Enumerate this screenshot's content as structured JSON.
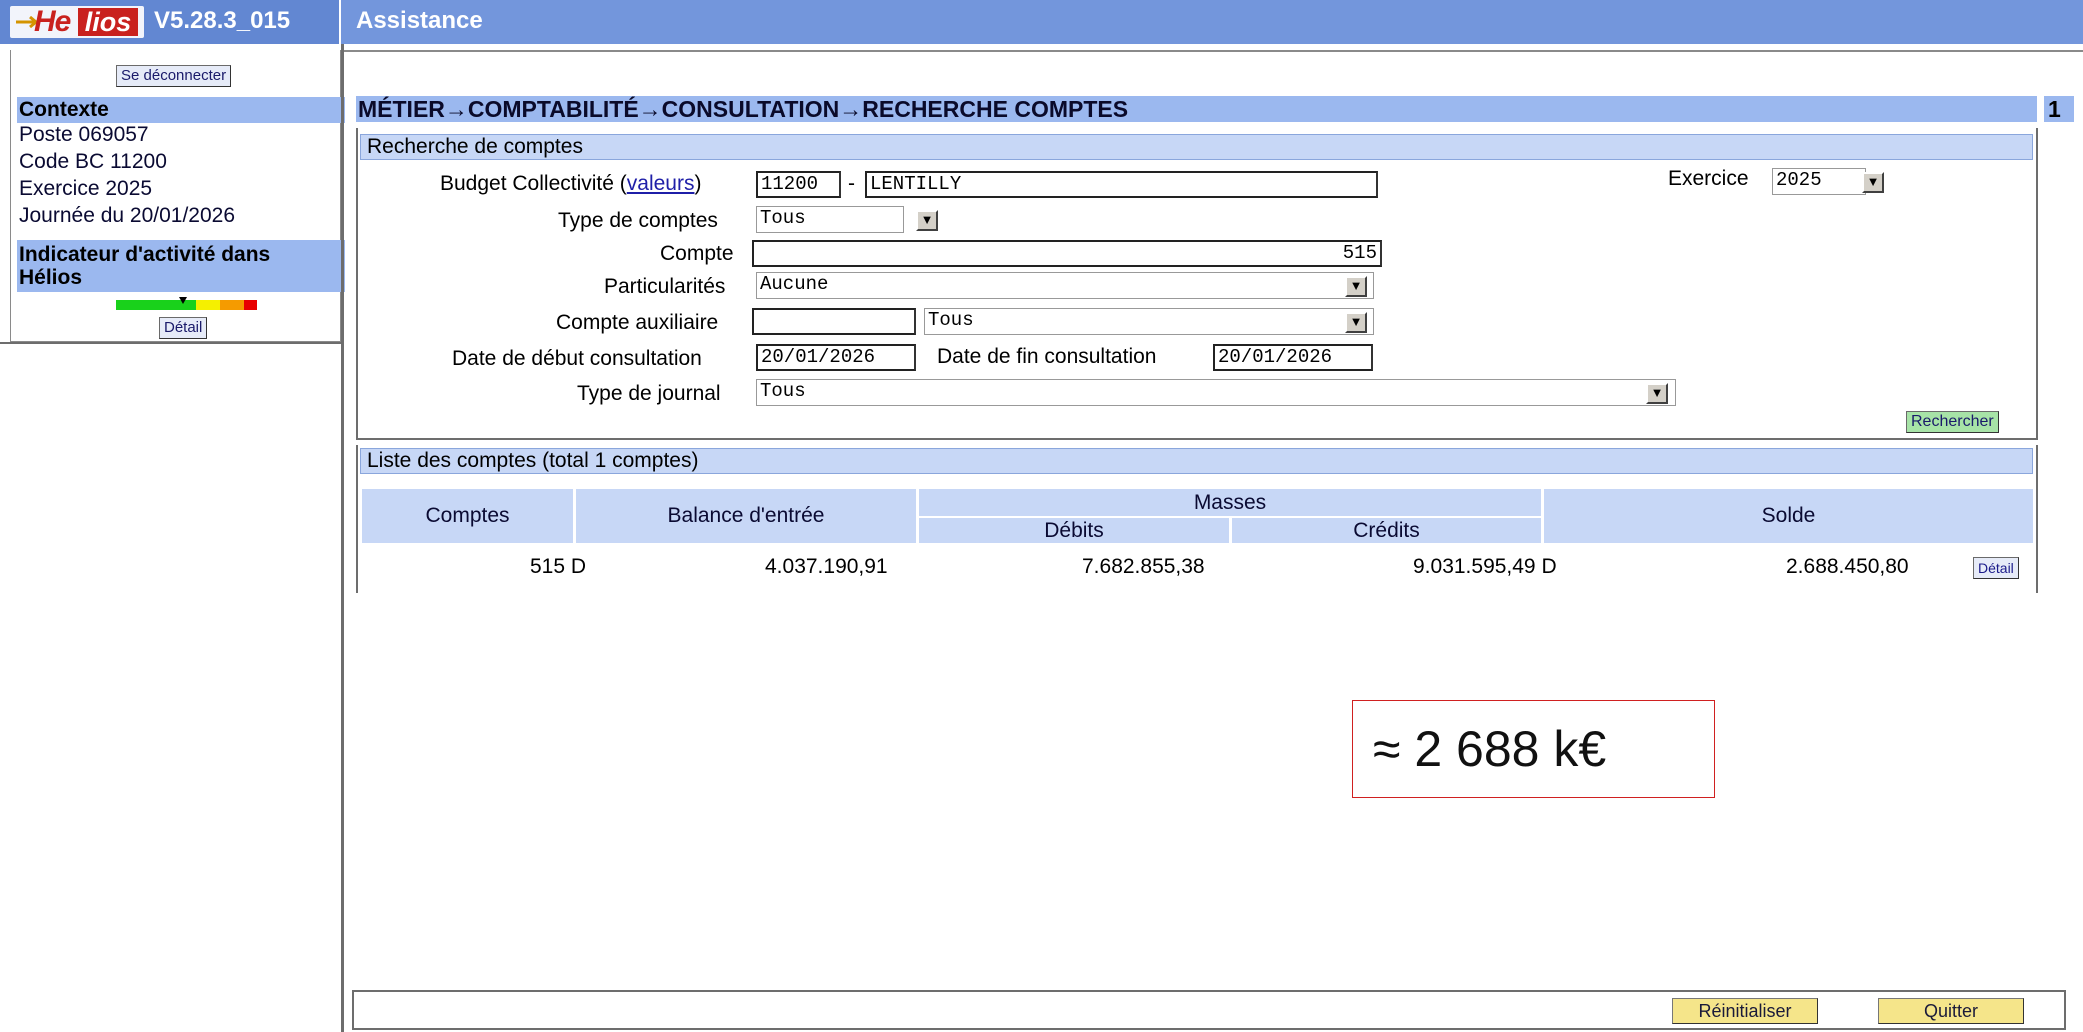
{
  "header": {
    "logo_text": "Helios",
    "version": "V5.28.3_015",
    "assistance": "Assistance"
  },
  "sidebar": {
    "logout_label": "Se déconnecter",
    "context_title": "Contexte",
    "context_lines": [
      "Poste 069057",
      "Code BC 11200",
      "Exercice 2025",
      "Journée du 20/01/2026"
    ],
    "indicator_title_line1": "Indicateur d'activité dans",
    "indicator_title_line2": "Hélios",
    "indicator_colors": [
      "#19d11b",
      "#f5f000",
      "#f59b00",
      "#e80000"
    ],
    "detail_label": "Détail"
  },
  "breadcrumb": "MÉTIER→COMPTABILITÉ→CONSULTATION→RECHERCHE COMPTES",
  "page_number": "1",
  "search": {
    "section_title": "Recherche de comptes",
    "budget_label": "Budget Collectivité",
    "budget_link": "valeurs",
    "budget_code": "11200",
    "budget_sep": "-",
    "budget_name": "LENTILLY",
    "exercice_label": "Exercice",
    "exercice_value": "2025",
    "type_comptes_label": "Type de comptes",
    "type_comptes_value": "Tous",
    "compte_label": "Compte",
    "compte_value": "515",
    "particularites_label": "Particularités",
    "particularites_value": "Aucune",
    "compte_aux_label": "Compte auxiliaire",
    "compte_aux_value": "",
    "compte_aux_type": "Tous",
    "date_debut_label": "Date de début consultation",
    "date_debut_value": "20/01/2026",
    "date_fin_label": "Date de fin consultation",
    "date_fin_value": "20/01/2026",
    "type_journal_label": "Type de journal",
    "type_journal_value": "Tous",
    "search_button": "Rechercher"
  },
  "list": {
    "title": "Liste des comptes (total 1 comptes)",
    "headers": {
      "comptes": "Comptes",
      "balance": "Balance d'entrée",
      "masses": "Masses",
      "debits": "Débits",
      "credits": "Crédits",
      "solde": "Solde"
    },
    "rows": [
      {
        "compte": "515 D",
        "balance": "4.037.190,91",
        "debits": "7.682.855,38",
        "credits": "9.031.595,49 D",
        "solde": "2.688.450,80",
        "detail": "Détail"
      }
    ]
  },
  "annotation": "≈  2 688 k€",
  "footer": {
    "reset_label": "Réinitialiser",
    "quit_label": "Quitter"
  }
}
